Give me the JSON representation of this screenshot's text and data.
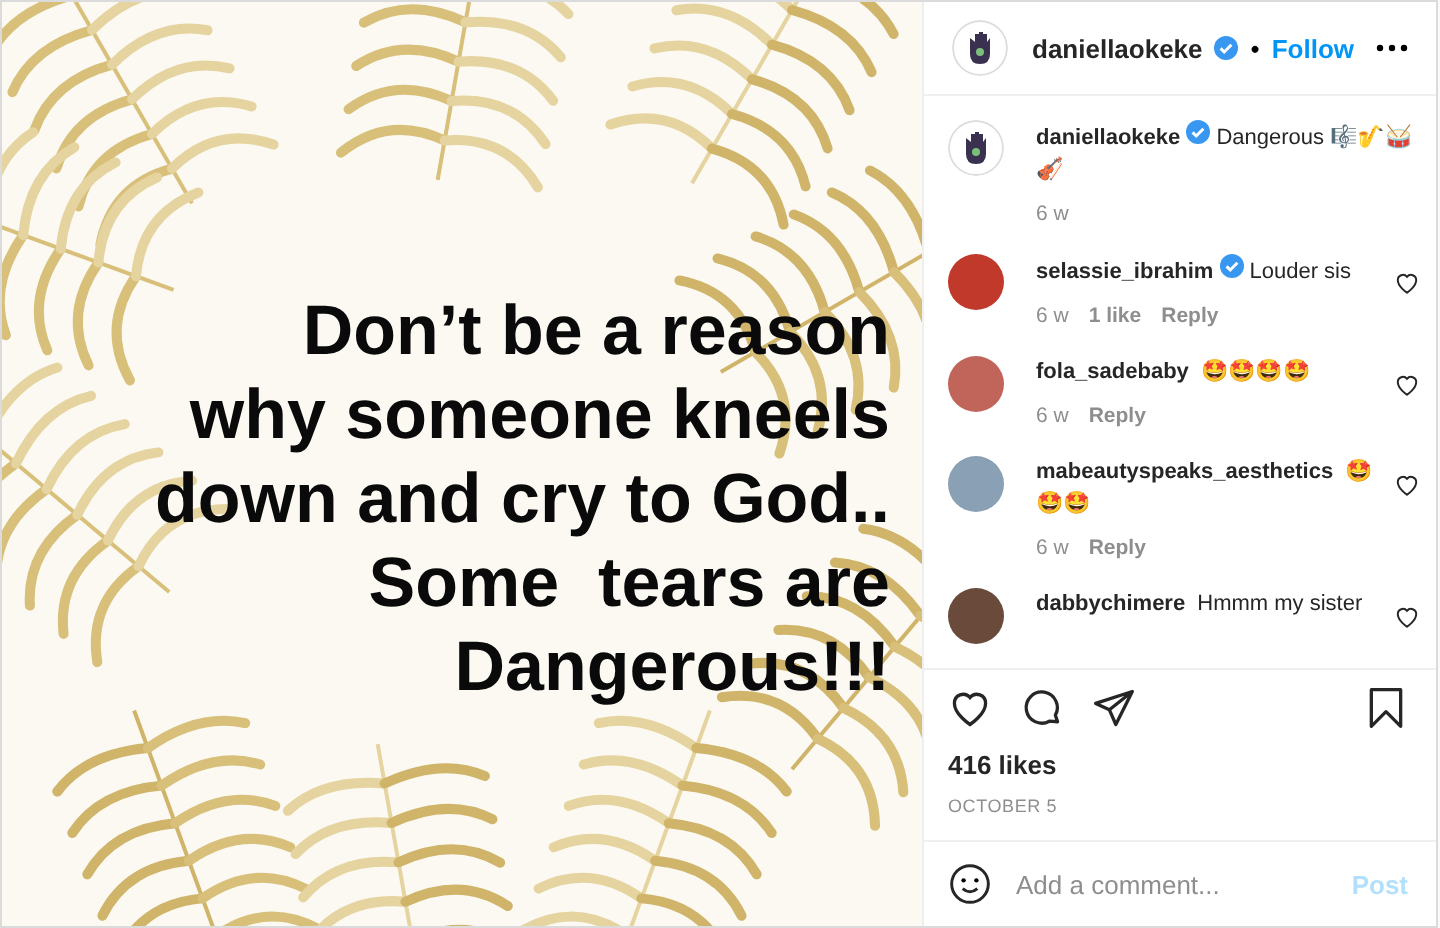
{
  "post_image": {
    "text_lines": [
      "Don’t be a reason",
      "why someone kneels",
      "down and cry to God..",
      "Some  tears are",
      "Dangerous!!!"
    ]
  },
  "header": {
    "username": "daniellaokeke",
    "verified": true,
    "separator": "•",
    "follow": "Follow"
  },
  "caption": {
    "username": "daniellaokeke",
    "verified": true,
    "text": "Dangerous 🎼🎷🥁🎻",
    "time": "6 w"
  },
  "comments": [
    {
      "username": "selassie_ibrahim",
      "verified": true,
      "text": "Louder sis",
      "time": "6 w",
      "likes": "1 like",
      "reply": "Reply",
      "liked": false
    },
    {
      "username": "fola_sadebaby",
      "verified": false,
      "text": "🤩🤩🤩🤩",
      "time": "6 w",
      "reply": "Reply",
      "liked": false
    },
    {
      "username": "mabeautyspeaks_aesthetics",
      "verified": false,
      "text": "🤩🤩🤩",
      "time": "6 w",
      "reply": "Reply",
      "liked": false
    },
    {
      "username": "dabbychimere",
      "verified": false,
      "text": "Hmmm my sister",
      "liked": false
    }
  ],
  "actions": {
    "liked": false,
    "saved": false
  },
  "likes": "416 likes",
  "date": "OCTOBER 5",
  "comment_box": {
    "placeholder": "Add a comment...",
    "post": "Post",
    "disabled": true
  }
}
